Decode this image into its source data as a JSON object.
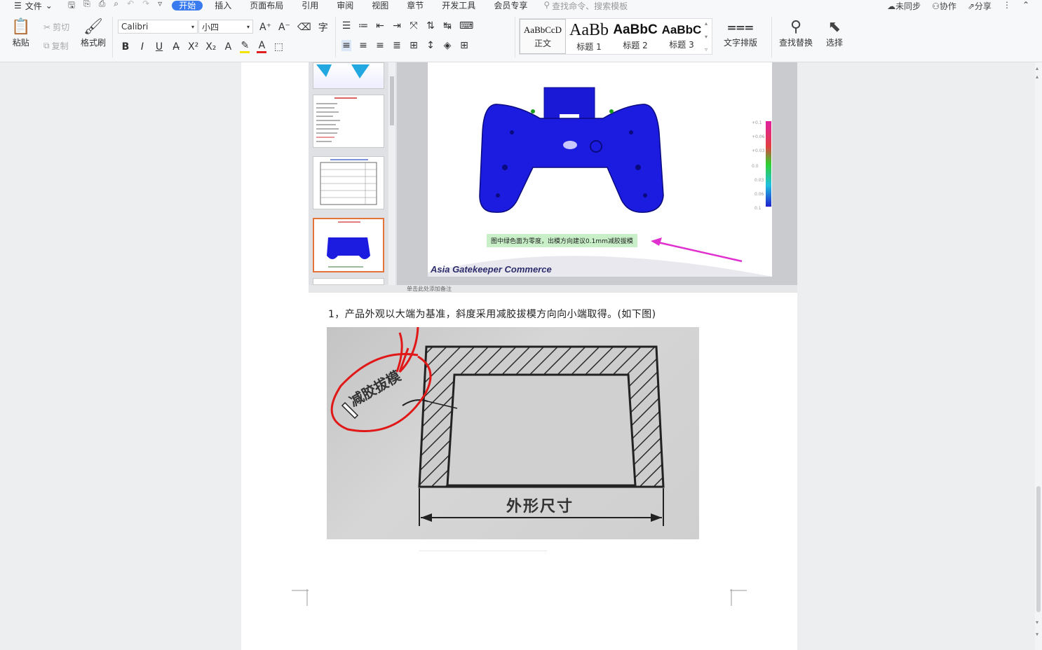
{
  "tabbar": {
    "file_label": "文件",
    "tabs": [
      "开始",
      "插入",
      "页面布局",
      "引用",
      "审阅",
      "视图",
      "章节",
      "开发工具",
      "会员专享"
    ],
    "search_placeholder": "查找命令、搜索模板",
    "right": [
      "未同步",
      "协作",
      "分享"
    ]
  },
  "ribbon": {
    "paste": "粘贴",
    "cut": "剪切",
    "copy": "复制",
    "format_painter": "格式刷",
    "font_name": "Calibri",
    "font_size": "小四",
    "styles": [
      {
        "preview": "AaBbCcD",
        "label": "正文"
      },
      {
        "preview": "AaBb",
        "label": "标题 1"
      },
      {
        "preview": "AaBbC",
        "label": "标题 2"
      },
      {
        "preview": "AaBbC",
        "label": "标题 3"
      }
    ],
    "text_layout": "文字排版",
    "find_replace": "查找替换",
    "select": "选择"
  },
  "embedded_slide": {
    "note": "图中绿色面为零度，出模方向建议0.1mm减胶拔模",
    "brand": "Asia Gatekeeper Commerce",
    "notes_bar": "单击此处添加备注"
  },
  "document": {
    "paragraph": "1，产品外观以大端为基准，斜度采用减胶拔模方向向小端取得。(如下图)",
    "photo_label_draft": "减胶拔模",
    "photo_label_dimension": "外形尺寸"
  },
  "colors": {
    "accent": "#3a7cf0",
    "annotation_red": "#e01818",
    "part_blue": "#1c1ce0",
    "arrow_magenta": "#e030d0"
  }
}
